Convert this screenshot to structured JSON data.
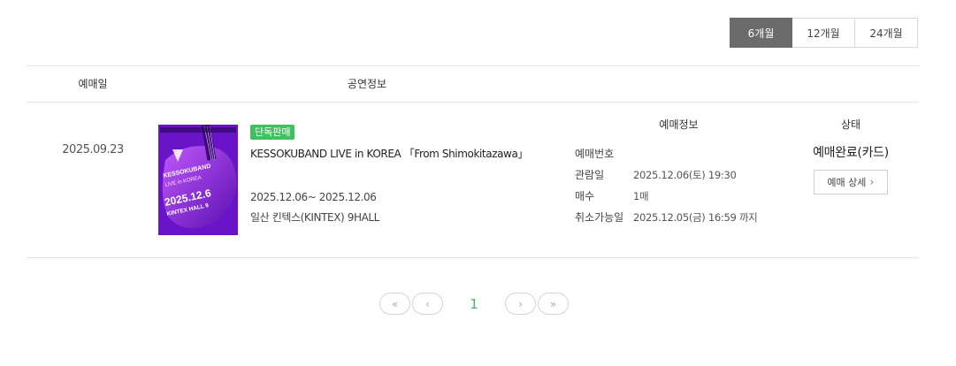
{
  "period_tabs": [
    {
      "label": "6개월",
      "active": true
    },
    {
      "label": "12개월",
      "active": false
    },
    {
      "label": "24개월",
      "active": false
    }
  ],
  "table": {
    "headers": {
      "date": "예매일",
      "performance": "공연정보",
      "reservation": "예매정보",
      "status": "상태"
    },
    "rows": [
      {
        "booking_date": "2025.09.23",
        "poster_text": {
          "line1": "KESSOKUBAND",
          "line2": "LIVE in KOREA",
          "line3": "2025.12.6",
          "line4": "KINTEX HALL 9"
        },
        "badge": "단독판매",
        "title": "KESSOKUBAND LIVE in KOREA 「From Shimokitazawa」",
        "period": "2025.12.06~ 2025.12.06",
        "venue": "일산 킨텍스(KINTEX) 9HALL",
        "reservation": [
          {
            "label": "예매번호",
            "value": ""
          },
          {
            "label": "관람일",
            "value": "2025.12.06(토) 19:30"
          },
          {
            "label": "매수",
            "value": "1매"
          },
          {
            "label": "취소가능일",
            "value": "2025.12.05(금) 16:59 까지"
          }
        ],
        "status": "예매완료(카드)",
        "detail_button": "예매 상세"
      }
    ]
  },
  "pagination": {
    "first": "«",
    "prev": "‹",
    "current": "1",
    "next": "›",
    "last": "»"
  },
  "colors": {
    "accent_green": "#3fc160",
    "active_tab": "#6b6b6b",
    "poster_purple": "#8b2be2"
  }
}
